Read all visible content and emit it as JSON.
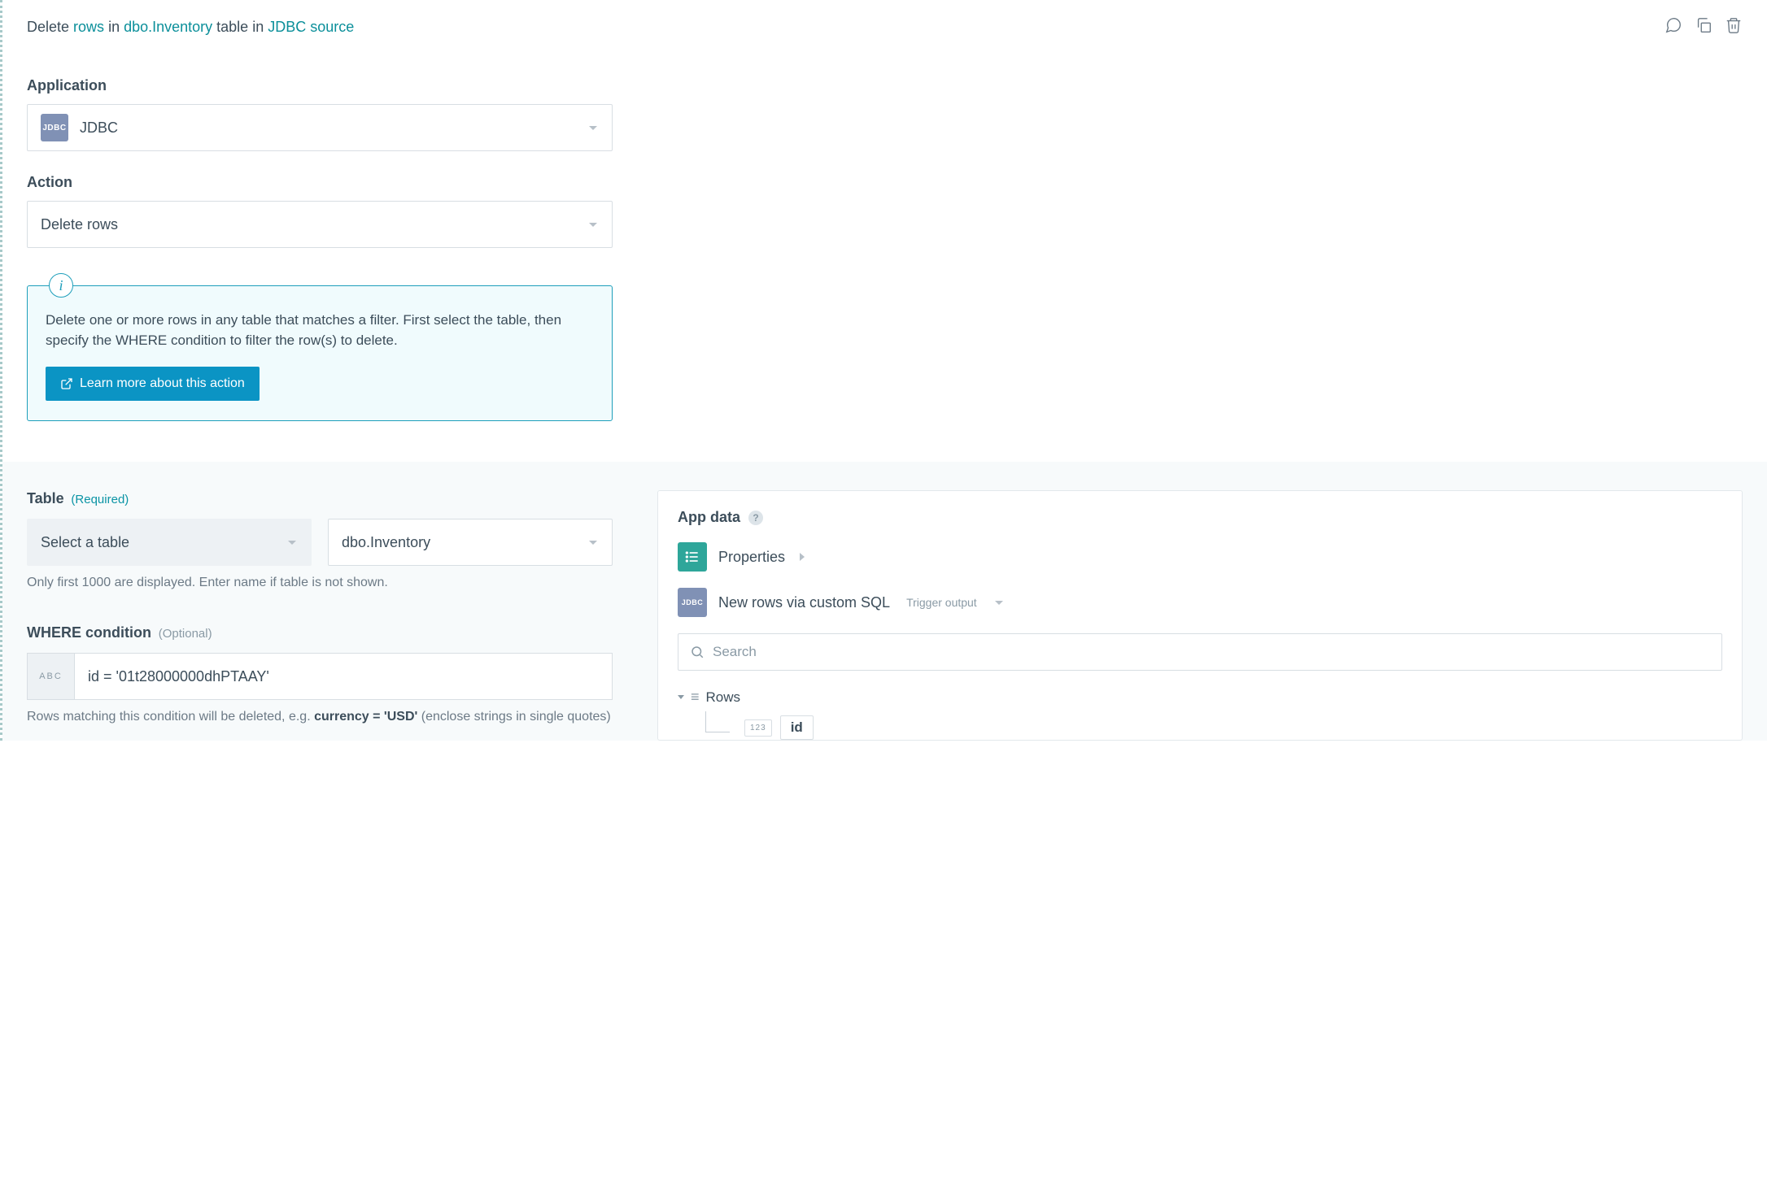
{
  "title": {
    "prefix": "Delete ",
    "rows": "rows",
    "mid1": " in ",
    "table": "dbo.Inventory",
    "mid2": " table in ",
    "source": "JDBC source"
  },
  "fields": {
    "application_label": "Application",
    "application_value": "JDBC",
    "jdbc_badge": "JDBC",
    "action_label": "Action",
    "action_value": "Delete rows"
  },
  "info": {
    "icon_char": "i",
    "text": "Delete one or more rows in any table that matches a filter. First select the table, then specify the WHERE condition to filter the row(s) to delete.",
    "learn_label": "Learn more about this action"
  },
  "table_section": {
    "label": "Table",
    "required": "(Required)",
    "select_label": "Select a table",
    "value": "dbo.Inventory",
    "hint": "Only first 1000 are displayed. Enter name if table is not shown."
  },
  "where": {
    "label": "WHERE condition",
    "optional": "(Optional)",
    "abc": "ABC",
    "value": "id = '01t28000000dhPTAAY'",
    "hint_pre": "Rows matching this condition will be deleted, e.g. ",
    "hint_bold": "currency = 'USD'",
    "hint_post": " (enclose strings in single quotes)"
  },
  "panel": {
    "title": "App data",
    "help": "?",
    "properties_label": "Properties",
    "jdbc_badge": "JDBC",
    "newrows_label": "New rows via custom SQL",
    "newrows_sub": "Trigger output",
    "search_placeholder": "Search",
    "rows_label": "Rows",
    "id_type": "123",
    "id_label": "id"
  }
}
